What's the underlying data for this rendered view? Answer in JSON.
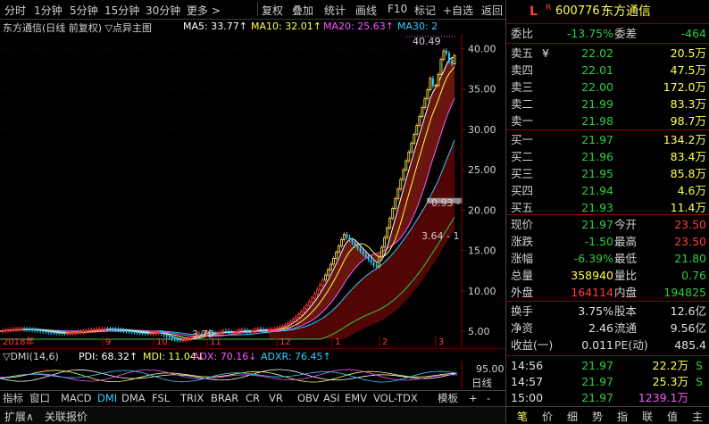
{
  "toolbar": {
    "items": [
      "分时",
      "1分钟",
      "5分钟",
      "15分钟",
      "30分钟",
      "更多 >",
      "复权",
      "叠加",
      "统计",
      "画线",
      "F10",
      "标记",
      "+自选",
      "返回"
    ]
  },
  "chart_header": {
    "title": "东方通信(日线 前复权) ▽点异主图",
    "ma5": "MA5: 33.77↑",
    "ma10": "MA10: 32.01↑",
    "ma20": "MA20: 25.63↑",
    "ma30": "MA30: 2"
  },
  "main_chart": {
    "high_label": "40.49",
    "low_label": "3.79",
    "mid_labels": [
      "0.93 -",
      "3.64 - 1"
    ],
    "year_label": "2018年",
    "month_labels": [
      "9",
      "10",
      "11",
      "12",
      "1",
      "2",
      "3"
    ],
    "price_axis": [
      "40.00",
      "35.00",
      "30.00",
      "25.00",
      "20.00",
      "15.00",
      "10.00",
      "5.00"
    ]
  },
  "indicator": {
    "name": "▽DMI(14,6)",
    "pdi": "PDI: 68.32↑",
    "mdi": "MDI: 11.04↓",
    "adx": "ADX: 70.16↓",
    "adxr": "ADXR: 76.45↑",
    "axis_label": "95.00"
  },
  "tabs": [
    "指标",
    "窗口",
    "MACD",
    "DMI",
    "DMA",
    "FSL",
    "TRIX",
    "BRAR",
    "CR",
    "VR",
    "OBV",
    "ASI",
    "EMV",
    "VOL-TDX",
    "模板",
    "+",
    "-",
    "日线"
  ],
  "status_bar": {
    "left": "扩展∧",
    "right": "关联报价"
  },
  "panel": {
    "mark": "L",
    "mark_sup": "R",
    "code": "600776",
    "name": "东方通信",
    "weibi_label": "委比",
    "weibi": "-13.75%",
    "weicha_label": "委差",
    "weicha": "-464",
    "asks": [
      {
        "label": "卖五",
        "mark": "¥",
        "price": "22.02",
        "vol": "20.5万"
      },
      {
        "label": "卖四",
        "mark": "",
        "price": "22.01",
        "vol": "47.5万"
      },
      {
        "label": "卖三",
        "mark": "",
        "price": "22.00",
        "vol": "172.0万"
      },
      {
        "label": "卖二",
        "mark": "",
        "price": "21.99",
        "vol": "83.3万"
      },
      {
        "label": "卖一",
        "mark": "",
        "price": "21.98",
        "vol": "98.7万"
      }
    ],
    "bids": [
      {
        "label": "买一",
        "price": "21.97",
        "vol": "134.2万"
      },
      {
        "label": "买二",
        "price": "21.96",
        "vol": "83.4万"
      },
      {
        "label": "买三",
        "price": "21.95",
        "vol": "85.8万"
      },
      {
        "label": "买四",
        "price": "21.94",
        "vol": "4.6万"
      },
      {
        "label": "买五",
        "price": "21.93",
        "vol": "11.4万"
      }
    ],
    "stats1": [
      {
        "l1": "现价",
        "v1": "21.97",
        "c1": "dn",
        "l2": "今开",
        "v2": "23.50",
        "c2": "up"
      },
      {
        "l1": "涨跌",
        "v1": "-1.50",
        "c1": "dn",
        "l2": "最高",
        "v2": "23.50",
        "c2": "up"
      },
      {
        "l1": "涨幅",
        "v1": "-6.39%",
        "c1": "dn",
        "l2": "最低",
        "v2": "21.80",
        "c2": "dn"
      },
      {
        "l1": "总量",
        "v1": "358940",
        "c1": "yl",
        "l2": "量比",
        "v2": "0.76",
        "c2": "dn"
      },
      {
        "l1": "外盘",
        "v1": "164114",
        "c1": "up",
        "l2": "内盘",
        "v2": "194825",
        "c2": "dn"
      }
    ],
    "stats2": [
      {
        "l1": "换手",
        "v1": "3.75%",
        "l2": "股本",
        "v2": "12.6亿"
      },
      {
        "l1": "净资",
        "v1": "2.46",
        "l2": "流通",
        "v2": "9.56亿"
      },
      {
        "l1": "收益(一)",
        "v1": "0.011",
        "l2": "PE(动)",
        "v2": "485.4"
      }
    ],
    "ticks": [
      {
        "time": "14:56",
        "price": "21.97",
        "vol": "22.2万",
        "flag": "S",
        "vc": "yl"
      },
      {
        "time": "14:57",
        "price": "21.97",
        "vol": "25.3万",
        "flag": "S",
        "vc": "yl"
      },
      {
        "time": "15:00",
        "price": "21.97",
        "vol": "1239.1万",
        "flag": "",
        "vc": "mg"
      }
    ],
    "bottom_tabs": [
      "笔",
      "价",
      "细",
      "势",
      "指",
      "联",
      "值",
      "主"
    ]
  },
  "colors": {
    "up": "#ff3c3c",
    "down": "#2ecc40",
    "ma5": "#ffffff",
    "ma10": "#ffff54",
    "ma20": "#ff55ff",
    "ma30": "#33ccff"
  }
}
